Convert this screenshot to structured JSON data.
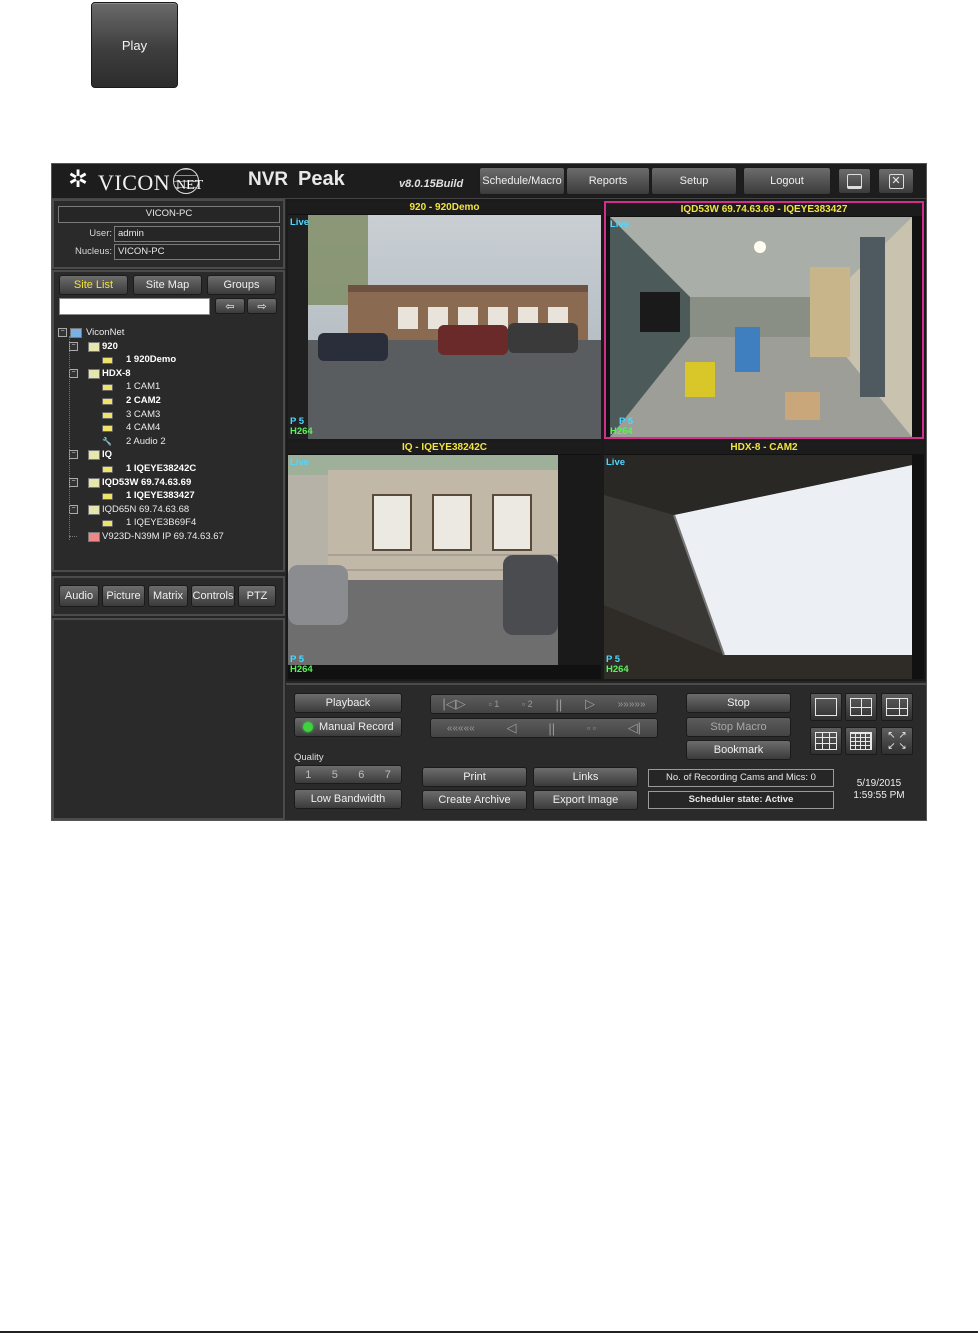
{
  "play_button": {
    "label": "Play"
  },
  "app": {
    "logo_text": "VICON",
    "logo_sub": "NET",
    "product_a": "NVR",
    "product_b": "Peak",
    "version": "v8.0.15Build",
    "menu": [
      {
        "label": "Schedule/Macro"
      },
      {
        "label": "Reports"
      },
      {
        "label": "Setup"
      }
    ],
    "logout_label": "Logout",
    "minimize_icon": "minimize-icon",
    "close_icon": "close-icon"
  },
  "server": {
    "name": "VICON-PC",
    "user_label": "User:",
    "user": "admin",
    "nucleus_label": "Nucleus:",
    "nucleus": "VICON-PC"
  },
  "site_tabs": [
    {
      "label": "Site List",
      "active": true
    },
    {
      "label": "Site Map"
    },
    {
      "label": "Groups"
    }
  ],
  "search": {
    "value": "",
    "prev_icon": "arrow-left-icon",
    "next_icon": "arrow-right-icon"
  },
  "tree": [
    {
      "label": "ViconNet",
      "level": 0,
      "icon": "network-icon",
      "bold": false
    },
    {
      "label": "920",
      "level": 1,
      "icon": "server-icon",
      "bold": true
    },
    {
      "label": "1  920Demo",
      "level": 2,
      "icon": "camera-icon",
      "bold": true
    },
    {
      "label": "HDX-8",
      "level": 1,
      "icon": "server-icon",
      "bold": true
    },
    {
      "label": "1  CAM1",
      "level": 2,
      "icon": "camera-icon",
      "bold": false
    },
    {
      "label": "2  CAM2",
      "level": 2,
      "icon": "camera-icon",
      "bold": true
    },
    {
      "label": "3  CAM3",
      "level": 2,
      "icon": "camera-icon",
      "bold": false
    },
    {
      "label": "4  CAM4",
      "level": 2,
      "icon": "camera-icon",
      "bold": false
    },
    {
      "label": "2  Audio 2",
      "level": 2,
      "icon": "microphone-icon",
      "bold": false
    },
    {
      "label": "IQ",
      "level": 1,
      "icon": "server-icon",
      "bold": true
    },
    {
      "label": "1  IQEYE38242C",
      "level": 2,
      "icon": "camera-icon",
      "bold": true
    },
    {
      "label": "IQD53W 69.74.63.69",
      "level": 1,
      "icon": "server-icon",
      "bold": true
    },
    {
      "label": "1  IQEYE383427",
      "level": 2,
      "icon": "camera-icon",
      "bold": true
    },
    {
      "label": "IQD65N 69.74.63.68",
      "level": 1,
      "icon": "server-icon",
      "bold": false
    },
    {
      "label": "1  IQEYE3B69F4",
      "level": 2,
      "icon": "camera-icon",
      "bold": false
    },
    {
      "label": "V923D-N39M IP 69.74.63.67",
      "level": 1,
      "icon": "device-error-icon",
      "bold": false
    }
  ],
  "function_tabs": [
    {
      "label": "Audio"
    },
    {
      "label": "Picture"
    },
    {
      "label": "Matrix"
    },
    {
      "label": "Controls"
    },
    {
      "label": "PTZ"
    }
  ],
  "tiles": [
    {
      "title": "920  -  920Demo",
      "live": "Live",
      "p": "P  5",
      "codec": "H264",
      "selected": false
    },
    {
      "title": "IQD53W 69.74.63.69  -  IQEYE383427",
      "live": "Live",
      "p": "P  5",
      "codec": "H264",
      "selected": true
    },
    {
      "title": "IQ  -  IQEYE38242C",
      "live": "Live",
      "p": "P  5",
      "codec": "H264",
      "selected": false
    },
    {
      "title": "HDX-8  -  CAM2",
      "live": "Live",
      "p": "P  5",
      "codec": "H264",
      "selected": false
    }
  ],
  "controls": {
    "playback_label": "Playback",
    "manual_record_label": "Manual Record",
    "quality_label": "Quality",
    "quality_values": [
      "1",
      "5",
      "6",
      "7"
    ],
    "low_bandwidth_label": "Low Bandwidth",
    "transport_top": [
      "|◁▷",
      "1",
      "2",
      "||",
      "▷",
      "2",
      "3",
      "4",
      "5",
      "6"
    ],
    "transport_bottom": [
      "≪",
      "≪",
      "≪",
      "≪",
      "◁",
      "||",
      "1",
      "2",
      "◁|"
    ],
    "print_label": "Print",
    "links_label": "Links",
    "create_archive_label": "Create Archive",
    "export_image_label": "Export Image",
    "stop_label": "Stop",
    "stop_macro_label": "Stop Macro",
    "bookmark_label": "Bookmark",
    "recording_status": "No. of Recording Cams and Mics: 0",
    "scheduler_status": "Scheduler state: Active",
    "date": "5/19/2015",
    "time": "1:59:55 PM"
  },
  "colors": {
    "title_yellow": "#f2e340",
    "overlay_cyan": "#4cd8ff",
    "overlay_green": "#5cf05c",
    "selected_border": "#d0308a",
    "record_led": "#3fd23f"
  }
}
